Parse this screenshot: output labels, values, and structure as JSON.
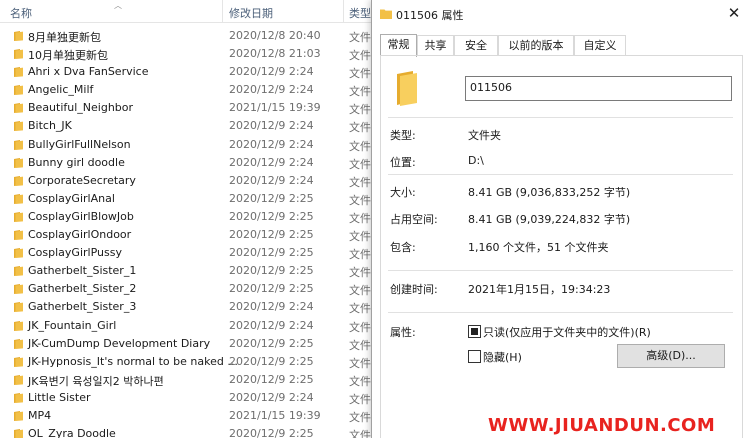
{
  "explorer": {
    "columns": {
      "name": "名称",
      "date": "修改日期",
      "type": "类型"
    },
    "rows": [
      {
        "name": "8月单独更新包",
        "date": "2020/12/8 20:40",
        "type": "文件"
      },
      {
        "name": "10月单独更新包",
        "date": "2020/12/8 21:03",
        "type": "文件"
      },
      {
        "name": "Ahri x Dva FanService",
        "date": "2020/12/9 2:24",
        "type": "文件"
      },
      {
        "name": "Angelic_Milf",
        "date": "2020/12/9 2:24",
        "type": "文件"
      },
      {
        "name": "Beautiful_Neighbor",
        "date": "2021/1/15 19:39",
        "type": "文件"
      },
      {
        "name": "Bitch_JK",
        "date": "2020/12/9 2:24",
        "type": "文件"
      },
      {
        "name": "BullyGirlFullNelson",
        "date": "2020/12/9 2:24",
        "type": "文件"
      },
      {
        "name": "Bunny girl doodle",
        "date": "2020/12/9 2:24",
        "type": "文件"
      },
      {
        "name": "CorporateSecretary",
        "date": "2020/12/9 2:24",
        "type": "文件"
      },
      {
        "name": "CosplayGirlAnal",
        "date": "2020/12/9 2:25",
        "type": "文件"
      },
      {
        "name": "CosplayGirlBlowJob",
        "date": "2020/12/9 2:25",
        "type": "文件"
      },
      {
        "name": "CosplayGirlOndoor",
        "date": "2020/12/9 2:25",
        "type": "文件"
      },
      {
        "name": "CosplayGirlPussy",
        "date": "2020/12/9 2:25",
        "type": "文件"
      },
      {
        "name": "Gatherbelt_Sister_1",
        "date": "2020/12/9 2:25",
        "type": "文件"
      },
      {
        "name": "Gatherbelt_Sister_2",
        "date": "2020/12/9 2:25",
        "type": "文件"
      },
      {
        "name": "Gatherbelt_Sister_3",
        "date": "2020/12/9 2:24",
        "type": "文件"
      },
      {
        "name": "JK_Fountain_Girl",
        "date": "2020/12/9 2:24",
        "type": "文件"
      },
      {
        "name": "JK-CumDump Development Diary",
        "date": "2020/12/9 2:25",
        "type": "文件"
      },
      {
        "name": "JK-Hypnosis_It's normal to be naked ...",
        "date": "2020/12/9 2:25",
        "type": "文件"
      },
      {
        "name": "JK육변기 육성일지2 박하나편",
        "date": "2020/12/9 2:25",
        "type": "文件"
      },
      {
        "name": "Little Sister",
        "date": "2020/12/9 2:24",
        "type": "文件"
      },
      {
        "name": "MP4",
        "date": "2021/1/15 19:39",
        "type": "文件"
      },
      {
        "name": "OL_Zyra Doodle",
        "date": "2020/12/9 2:25",
        "type": "文件"
      }
    ]
  },
  "dialog": {
    "title": "011506 属性",
    "close_glyph": "✕",
    "tabs": [
      "常规",
      "共享",
      "安全",
      "以前的版本",
      "自定义"
    ],
    "folder_name": "011506",
    "props": {
      "type_label": "类型:",
      "type_value": "文件夹",
      "location_label": "位置:",
      "location_value": "D:\\",
      "size_label": "大小:",
      "size_value": "8.41 GB (9,036,833,252 字节)",
      "disk_label": "占用空间:",
      "disk_value": "8.41 GB (9,039,224,832 字节)",
      "contains_label": "包含:",
      "contains_value": "1,160 个文件，51 个文件夹",
      "created_label": "创建时间:",
      "created_value": "2021年1月15日，19:34:23",
      "attr_label": "属性:",
      "readonly_label": "只读(仅应用于文件夹中的文件)(R)",
      "hidden_label": "隐藏(H)",
      "advanced_button": "高级(D)..."
    }
  },
  "watermark": "WWW.JIUANDUN.COM",
  "colors": {
    "folder": "#f2c047",
    "accent_watermark": "#e8231f"
  }
}
